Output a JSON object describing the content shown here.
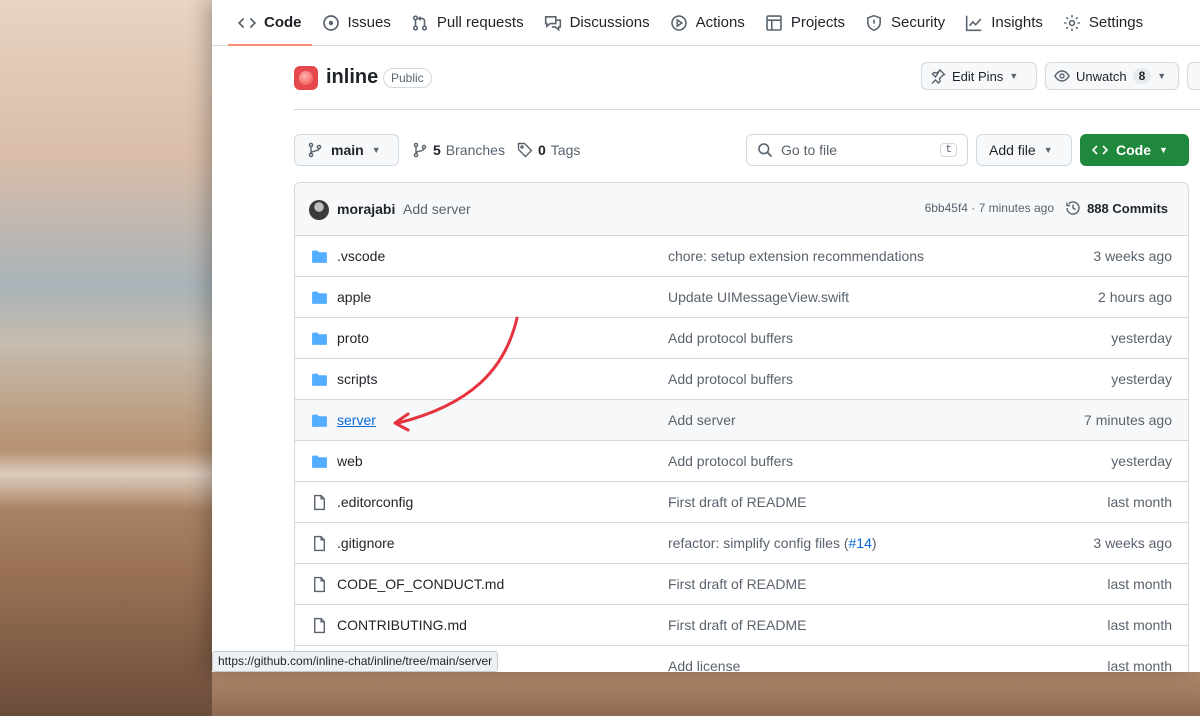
{
  "colors": {
    "accent_tab": "#fd8c73",
    "link": "#0969da",
    "primary_button": "#1f883d",
    "folder": "#54aeff",
    "annotation_arrow": "#e5343f"
  },
  "nav": {
    "tabs": [
      {
        "label": "Code",
        "icon": "code-icon"
      },
      {
        "label": "Issues",
        "icon": "issue-icon"
      },
      {
        "label": "Pull requests",
        "icon": "pull-request-icon"
      },
      {
        "label": "Discussions",
        "icon": "discussion-icon"
      },
      {
        "label": "Actions",
        "icon": "play-icon"
      },
      {
        "label": "Projects",
        "icon": "table-icon"
      },
      {
        "label": "Security",
        "icon": "shield-icon"
      },
      {
        "label": "Insights",
        "icon": "graph-icon"
      },
      {
        "label": "Settings",
        "icon": "gear-icon"
      }
    ]
  },
  "repo": {
    "name": "inline",
    "visibility": "Public",
    "edit_pins": "Edit Pins",
    "unwatch": "Unwatch",
    "watch_count": "8"
  },
  "toolbar": {
    "branch": "main",
    "branches_count": "5",
    "branches_label": "Branches",
    "tags_count": "0",
    "tags_label": "Tags",
    "search_placeholder": "Go to file",
    "search_shortcut": "t",
    "add_file": "Add file",
    "code": "Code"
  },
  "commit": {
    "author": "morajabi",
    "message": "Add server",
    "sha_time": "6bb45f4 · 7 minutes ago",
    "commits": "888 Commits"
  },
  "files": [
    {
      "name": ".vscode",
      "type": "folder",
      "message": "chore: setup extension recommendations",
      "date": "3 weeks ago"
    },
    {
      "name": "apple",
      "type": "folder",
      "message": "Update UIMessageView.swift",
      "date": "2 hours ago"
    },
    {
      "name": "proto",
      "type": "folder",
      "message": "Add protocol buffers",
      "date": "yesterday"
    },
    {
      "name": "scripts",
      "type": "folder",
      "message": "Add protocol buffers",
      "date": "yesterday"
    },
    {
      "name": "server",
      "type": "folder",
      "message": "Add server",
      "date": "7 minutes ago"
    },
    {
      "name": "web",
      "type": "folder",
      "message": "Add protocol buffers",
      "date": "yesterday"
    },
    {
      "name": ".editorconfig",
      "type": "file",
      "message": "First draft of README",
      "date": "last month"
    },
    {
      "name": ".gitignore",
      "type": "file",
      "message_prefix": "refactor: simplify config files (",
      "message_link": "#14",
      "message_suffix": ")",
      "date": "3 weeks ago"
    },
    {
      "name": "CODE_OF_CONDUCT.md",
      "type": "file",
      "message": "First draft of README",
      "date": "last month"
    },
    {
      "name": "CONTRIBUTING.md",
      "type": "file",
      "message": "First draft of README",
      "date": "last month"
    },
    {
      "name": "",
      "type": "file",
      "message": "Add license",
      "date": "last month"
    }
  ],
  "status_bar": {
    "url": "https://github.com/inline-chat/inline/tree/main/server"
  }
}
